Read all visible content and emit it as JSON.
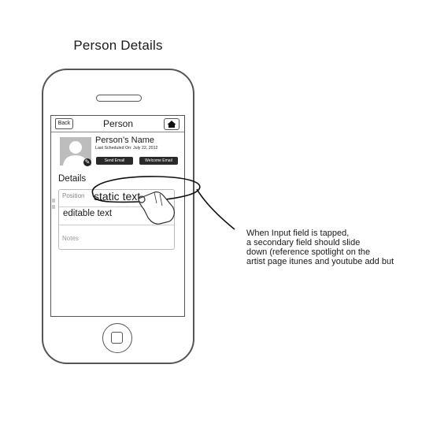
{
  "page_title": "Person Details",
  "phone": {
    "nav": {
      "back_label": "Back",
      "title": "Person",
      "home_icon": "house-icon"
    },
    "profile": {
      "name": "Person’s Name",
      "last_scheduled": "Last Scheduled On: July 22, 2012",
      "buttons": {
        "send_email": "Send Email",
        "welcome_email": "Welcome Email"
      }
    },
    "details": {
      "heading": "Details",
      "position_label": "Position",
      "static_value": "static text",
      "editable_value": "editable text",
      "notes_placeholder": "Notes"
    }
  },
  "annotation": {
    "lines": [
      "When Input field is tapped,",
      "a secondary field should slide",
      "down (reference spotlight on the",
      "artist page itunes and youtube add but"
    ]
  },
  "colors": {
    "outline": "#555555",
    "button_dark": "#2a2a2a",
    "avatar_gray": "#bdbdbd"
  }
}
